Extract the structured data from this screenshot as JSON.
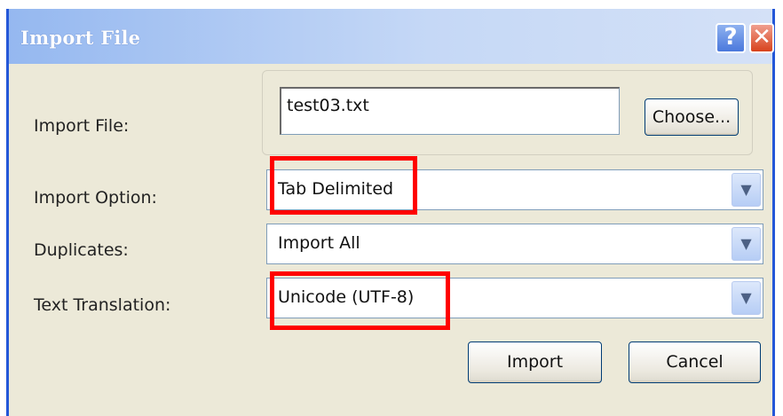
{
  "window": {
    "title": "Import File",
    "help_label": "?",
    "close_label": "✕"
  },
  "import_file": {
    "label": "Import File:",
    "value": "test03.txt",
    "choose_label": "Choose..."
  },
  "import_option": {
    "label": "Import Option:",
    "value": "Tab Delimited"
  },
  "duplicates": {
    "label": "Duplicates:",
    "value": "Import All"
  },
  "text_translation": {
    "label": "Text Translation:",
    "value": "Unicode (UTF-8)"
  },
  "buttons": {
    "import_label": "Import",
    "cancel_label": "Cancel"
  },
  "dropdown_icon": "chevron-down",
  "highlight_color": "#ff0000"
}
